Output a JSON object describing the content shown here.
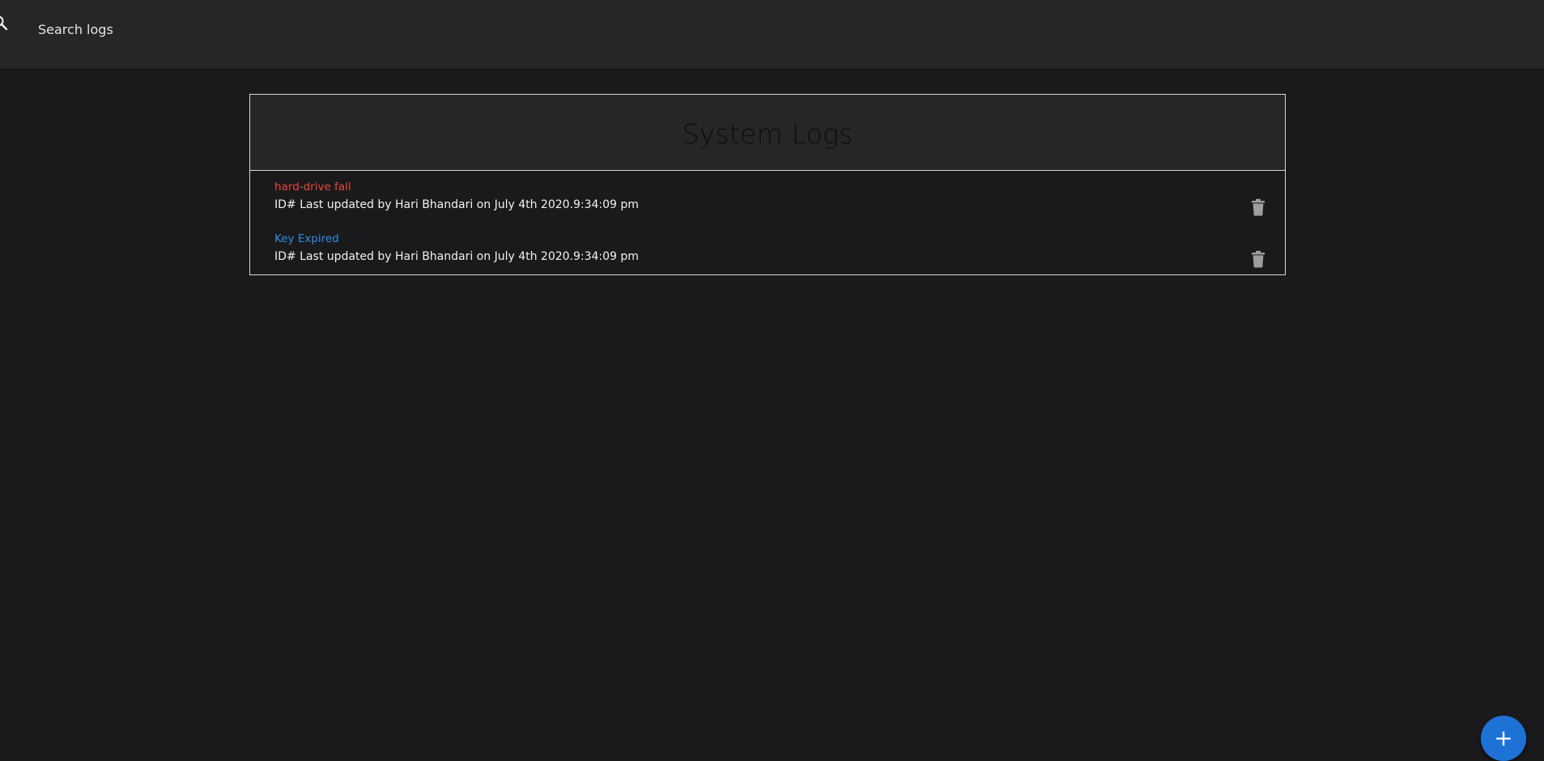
{
  "search": {
    "placeholder": "Search logs",
    "icon": "search-icon"
  },
  "logs_panel": {
    "title": "System Logs",
    "items": [
      {
        "title": "hard-drive fail",
        "title_color": "#e84a3c",
        "meta": "ID# Last updated by Hari Bhandari on July 4th 2020.9:34:09 pm",
        "action_icon": "trash-icon"
      },
      {
        "title": "Key Expired",
        "title_color": "#2f8ee4",
        "meta": "ID# Last updated by Hari Bhandari on July 4th 2020.9:34:09 pm",
        "action_icon": "trash-icon"
      }
    ]
  },
  "fab": {
    "label": "+",
    "color": "#1e72d6",
    "icon": "plus-icon"
  },
  "colors": {
    "background": "#1a191b",
    "topbar": "#262628"
  }
}
